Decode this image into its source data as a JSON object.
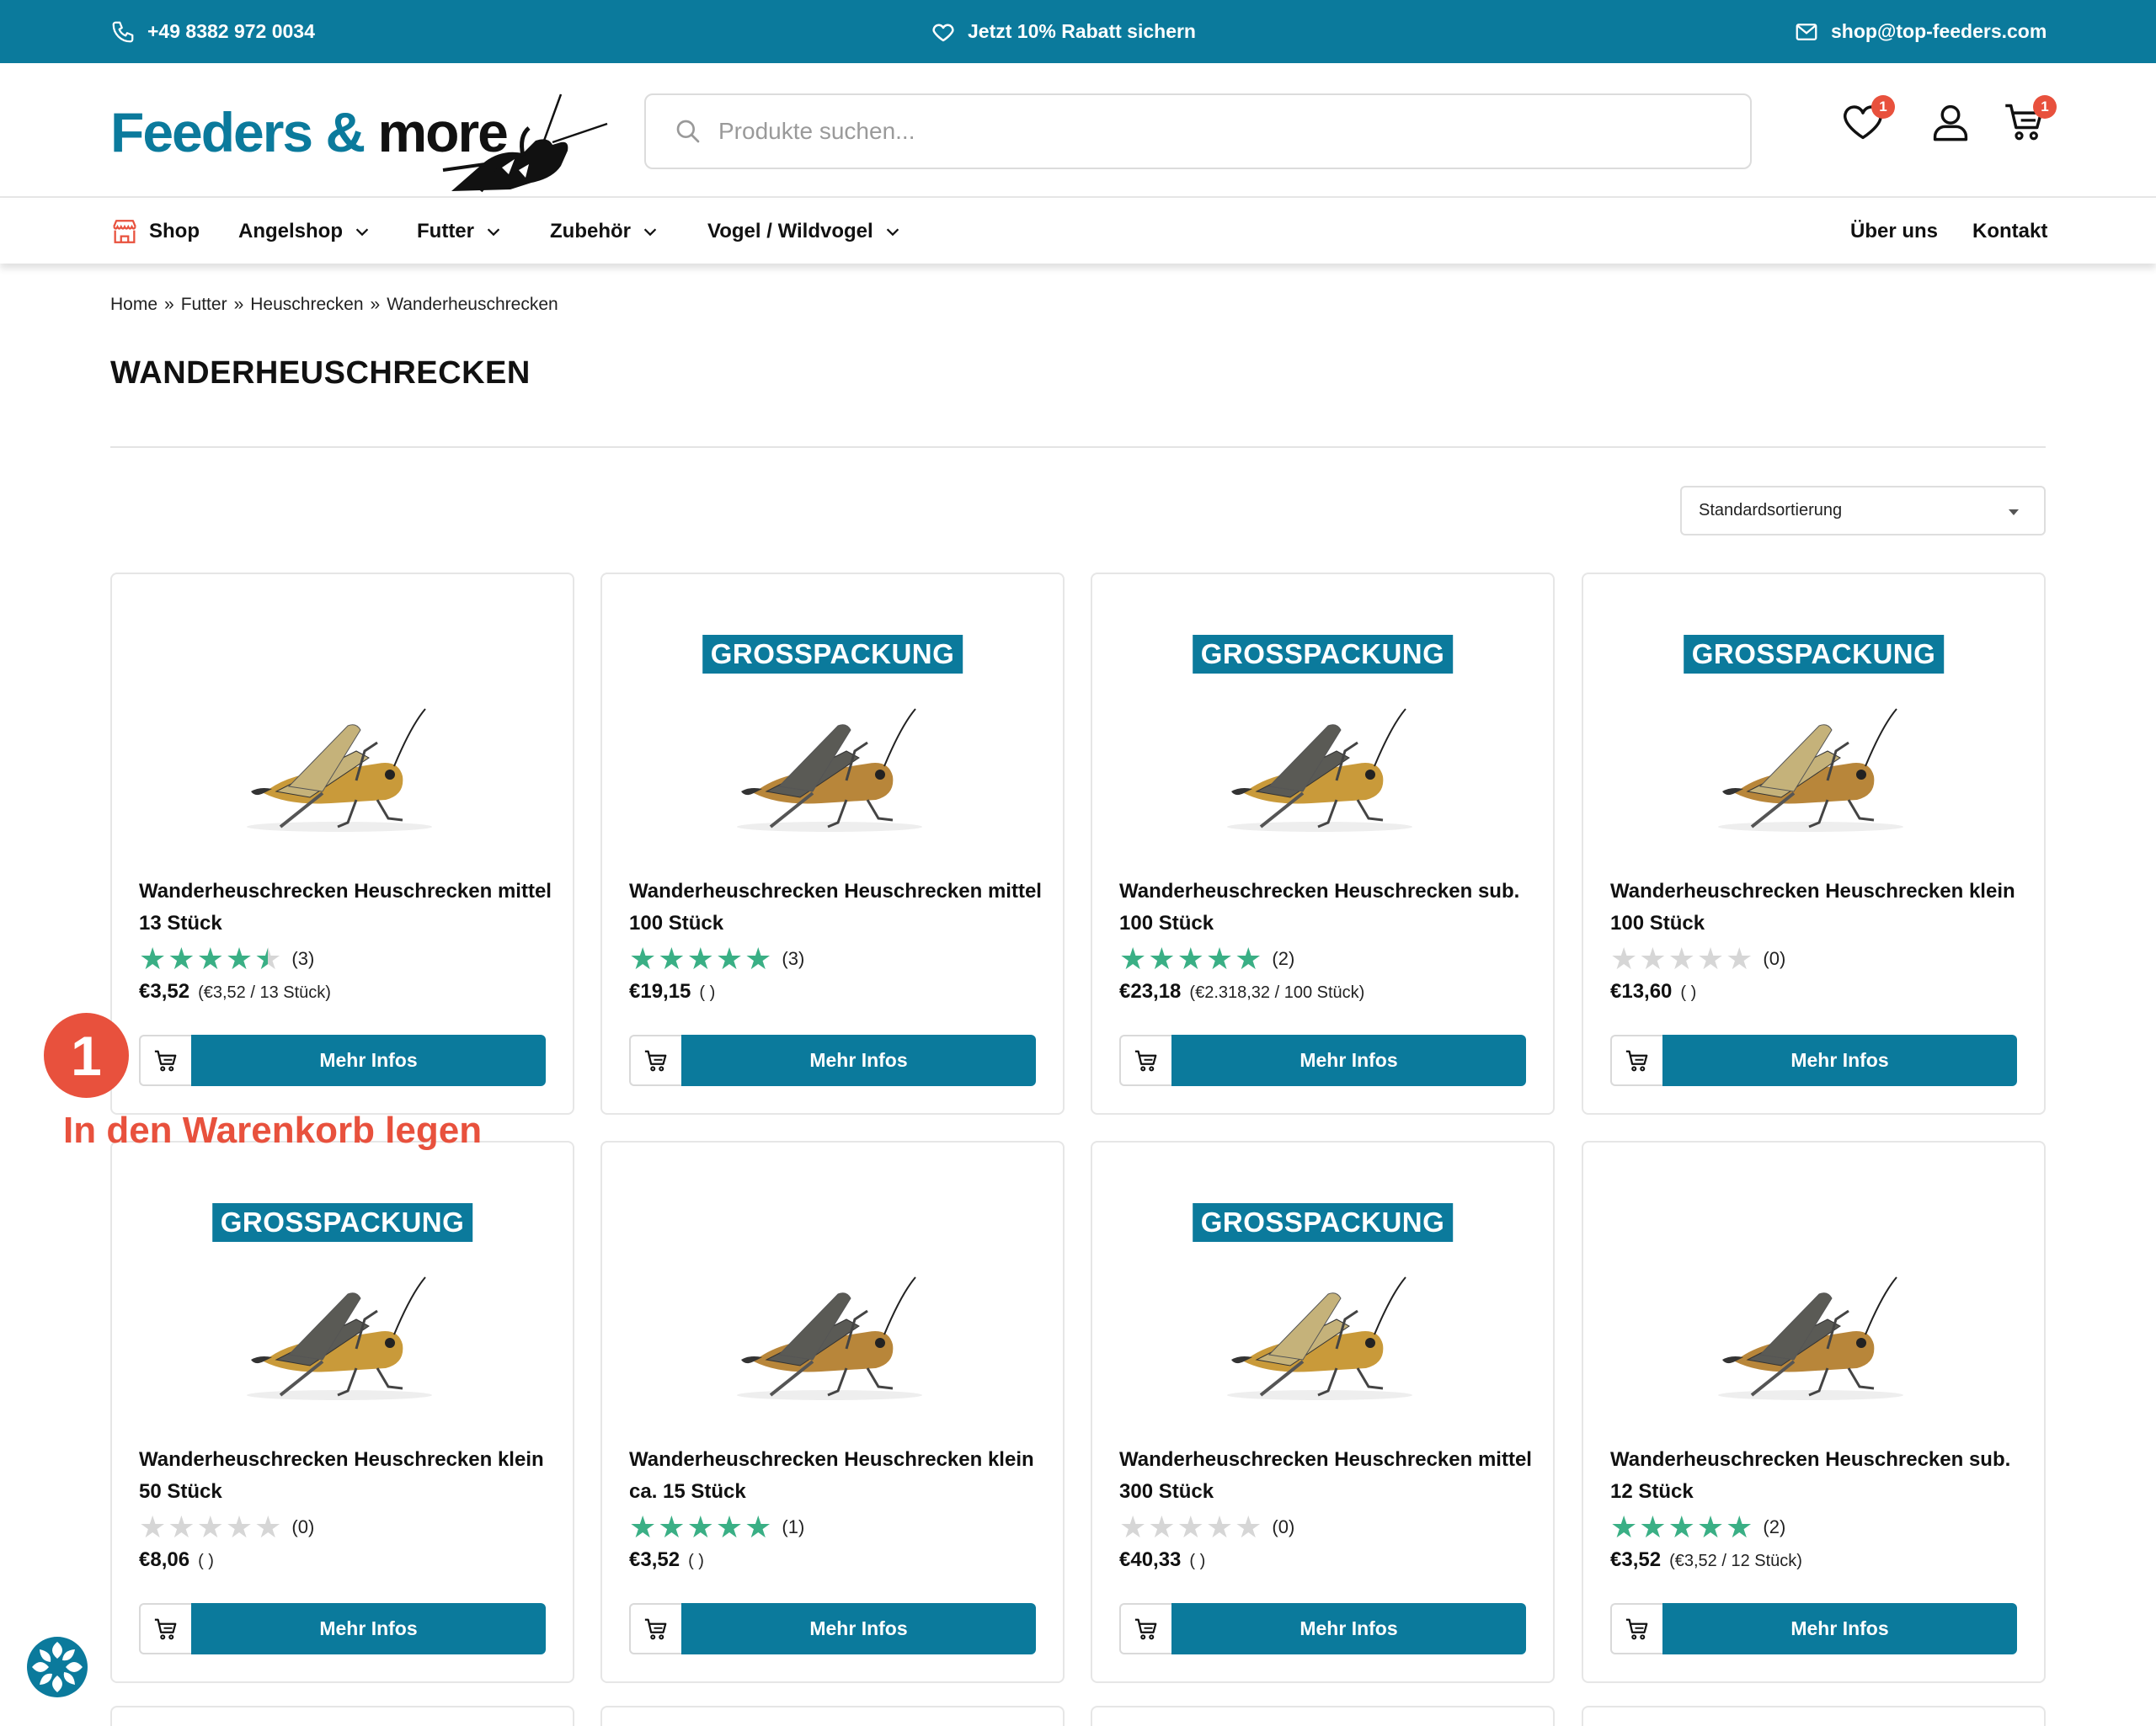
{
  "topbar": {
    "phone": "+49 8382 972 0034",
    "promo": "Jetzt 10% Rabatt sichern",
    "email": "shop@top-feeders.com"
  },
  "header": {
    "logo_part1": "Feeders &",
    "logo_part2": "more",
    "search_placeholder": "Produkte suchen...",
    "wishlist_count": "1",
    "cart_count": "1"
  },
  "nav": {
    "shop": "Shop",
    "angelshop": "Angelshop",
    "futter": "Futter",
    "zubehoer": "Zubehör",
    "vogel": "Vogel / Wildvogel",
    "ueber_uns": "Über uns",
    "kontakt": "Kontakt"
  },
  "breadcrumb": [
    "Home",
    "»",
    "Futter",
    "»",
    "Heuschrecken",
    "»",
    "Wanderheuschrecken"
  ],
  "page_title": "WANDERHEUSCHRECKEN",
  "sort": {
    "selected": "Standardsortierung"
  },
  "badge_text": "GROSSPACKUNG",
  "more_label": "Mehr Infos",
  "products": [
    {
      "name_line1": "Wanderheuschrecken Heuschrecken mittel",
      "name_line2": "13 Stück",
      "rating": 4.5,
      "count": "(3)",
      "price": "€3,52",
      "unit_price": "(€3,52 / 13 Stück)",
      "grosspackung": false
    },
    {
      "name_line1": "Wanderheuschrecken Heuschrecken mittel",
      "name_line2": "100 Stück",
      "rating": 5,
      "count": "(3)",
      "price": "€19,15",
      "unit_price": "( )",
      "grosspackung": true
    },
    {
      "name_line1": "Wanderheuschrecken Heuschrecken sub.",
      "name_line2": "100 Stück",
      "rating": 5,
      "count": "(2)",
      "price": "€23,18",
      "unit_price": "(€2.318,32 / 100 Stück)",
      "grosspackung": true
    },
    {
      "name_line1": "Wanderheuschrecken Heuschrecken klein",
      "name_line2": "100 Stück",
      "rating": 0,
      "count": "(0)",
      "price": "€13,60",
      "unit_price": "( )",
      "grosspackung": true
    },
    {
      "name_line1": "Wanderheuschrecken Heuschrecken klein",
      "name_line2": "50 Stück",
      "rating": 0,
      "count": "(0)",
      "price": "€8,06",
      "unit_price": "( )",
      "grosspackung": true
    },
    {
      "name_line1": "Wanderheuschrecken Heuschrecken klein",
      "name_line2": "ca. 15 Stück",
      "rating": 5,
      "count": "(1)",
      "price": "€3,52",
      "unit_price": "( )",
      "grosspackung": false
    },
    {
      "name_line1": "Wanderheuschrecken Heuschrecken mittel",
      "name_line2": "300 Stück",
      "rating": 0,
      "count": "(0)",
      "price": "€40,33",
      "unit_price": "( )",
      "grosspackung": true
    },
    {
      "name_line1": "Wanderheuschrecken Heuschrecken sub.",
      "name_line2": "12 Stück",
      "rating": 5,
      "count": "(2)",
      "price": "€3,52",
      "unit_price": "(€3,52 / 12 Stück)",
      "grosspackung": false
    }
  ],
  "annotation": {
    "number": "1",
    "label": "In den Warenkorb legen"
  },
  "colors": {
    "brand": "#0b7a9c",
    "star": "#3aaf85",
    "star_empty": "#d6d6d6",
    "annotation": "#e8513d"
  }
}
